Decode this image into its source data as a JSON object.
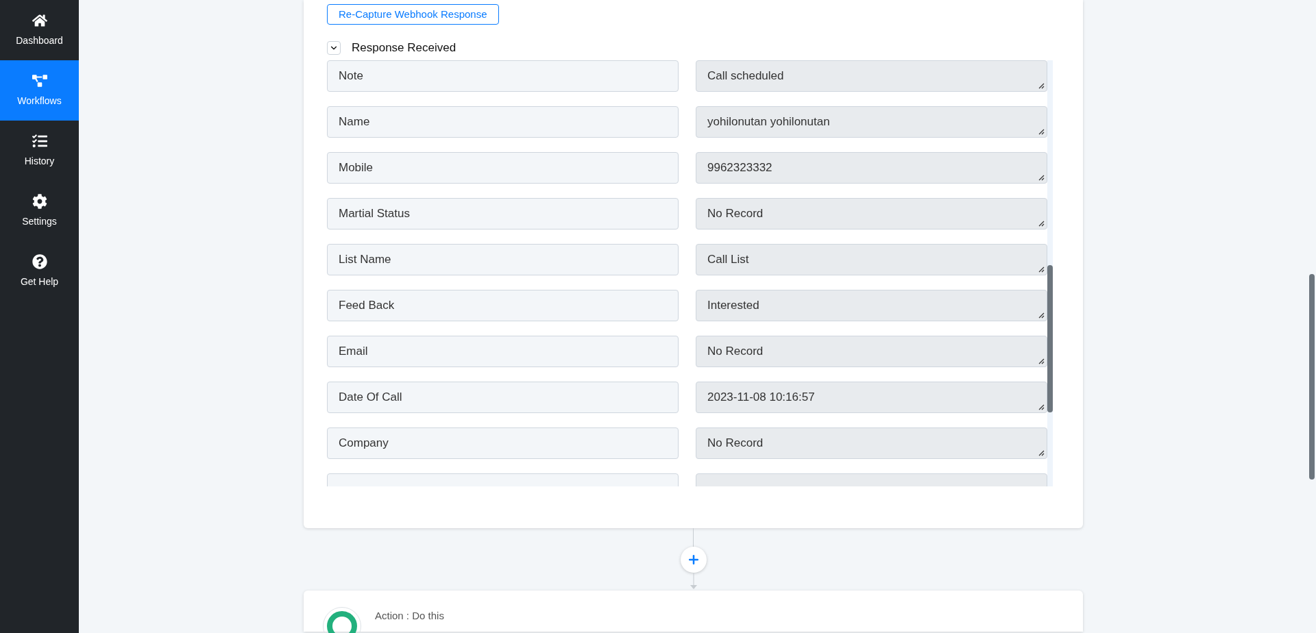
{
  "sidebar": {
    "items": [
      {
        "label": "Dashboard",
        "kind": "home",
        "selected": false
      },
      {
        "label": "Workflows",
        "kind": "workflow",
        "selected": true
      },
      {
        "label": "History",
        "kind": "history",
        "selected": false
      },
      {
        "label": "Settings",
        "kind": "settings",
        "selected": false
      },
      {
        "label": "Get Help",
        "kind": "help",
        "selected": false
      }
    ]
  },
  "card": {
    "recapture_button": "Re-Capture Webhook Response",
    "response": {
      "title": "Response Received",
      "expanded": true,
      "fields": [
        {
          "label": "Note",
          "value": "Call scheduled"
        },
        {
          "label": "Name",
          "value": "yohilonutan yohilonutan"
        },
        {
          "label": "Mobile",
          "value": "9962323332"
        },
        {
          "label": "Martial Status",
          "value": "No Record"
        },
        {
          "label": "List Name",
          "value": "Call List"
        },
        {
          "label": "Feed Back",
          "value": "Interested"
        },
        {
          "label": "Email",
          "value": "No Record"
        },
        {
          "label": "Date Of Call",
          "value": "2023-11-08 10:16:57"
        },
        {
          "label": "Company",
          "value": "No Record"
        }
      ]
    }
  },
  "action": {
    "title": "Action : Do this"
  }
}
